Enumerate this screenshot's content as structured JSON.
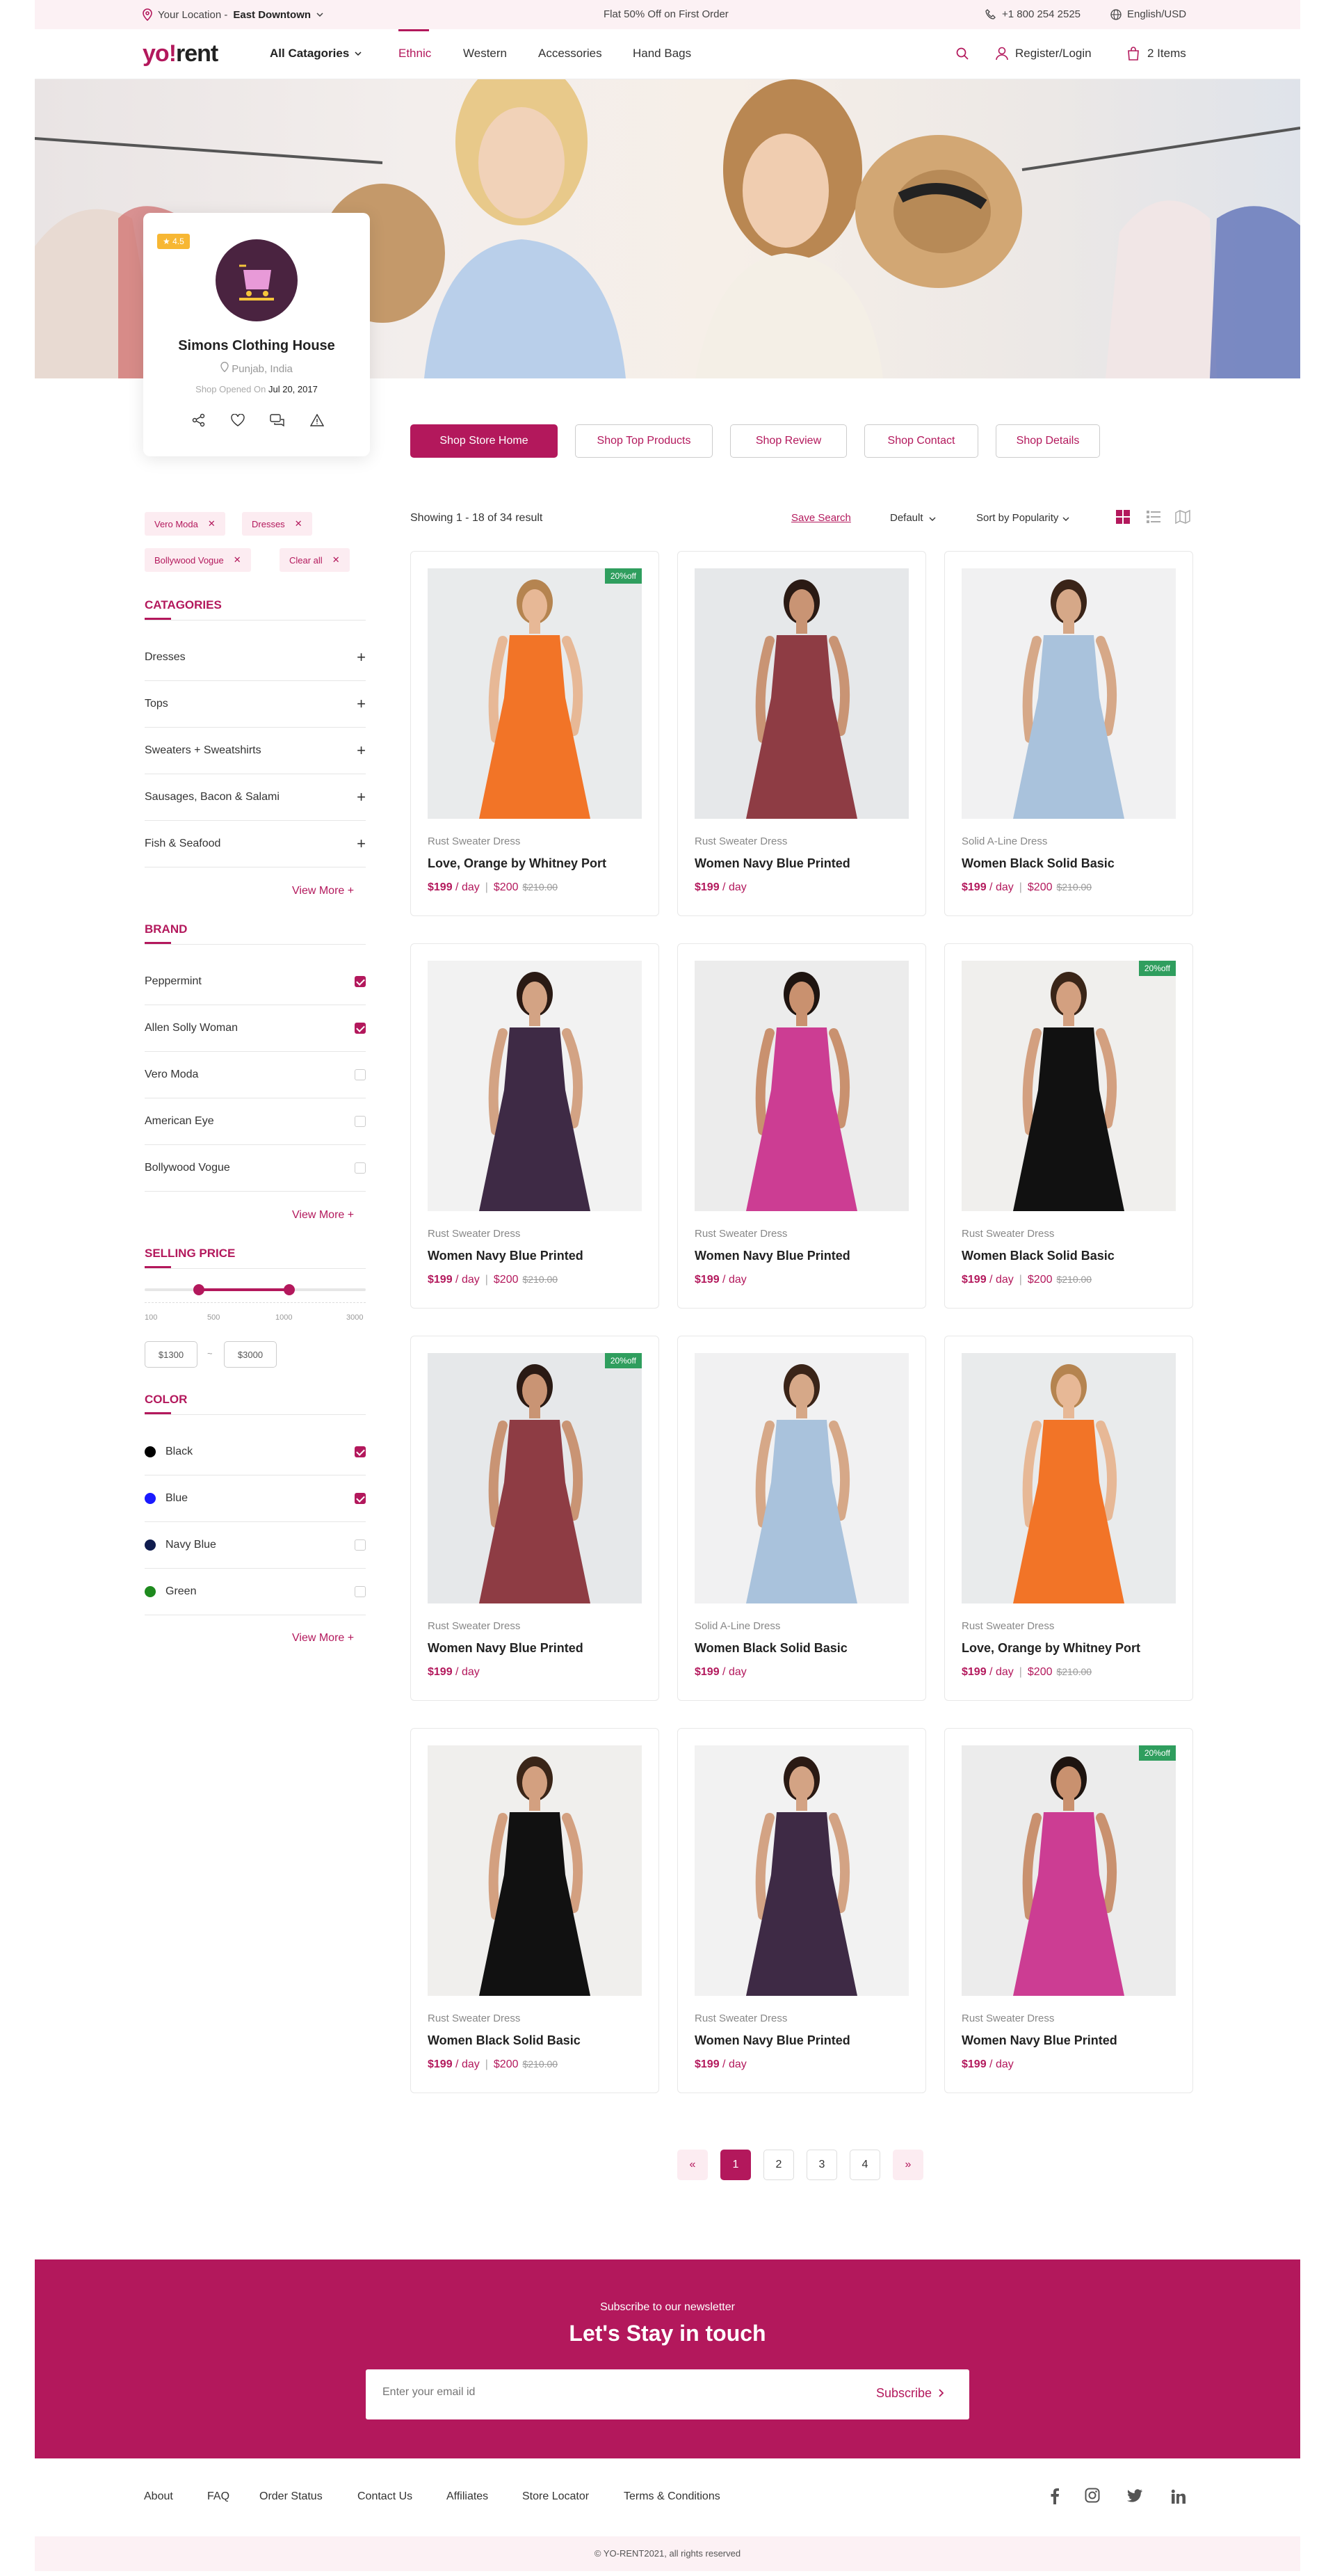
{
  "topbar": {
    "location_label": "Your Location -",
    "location_value": "East Downtown",
    "promo": "Flat 50% Off on First Order",
    "phone": "+1 800 254 2525",
    "language": "English/USD"
  },
  "header": {
    "logo_a": "yo",
    "logo_b": "!",
    "logo_c": "rent",
    "all_categories": "All Catagories",
    "nav": [
      "Ethnic",
      "Western",
      "Accessories",
      "Hand Bags"
    ],
    "register": "Register/Login",
    "cart": "2 Items"
  },
  "store": {
    "rating": "4.5",
    "name": "Simons Clothing House",
    "location": "Punjab, India",
    "opened_label": "Shop Opened On",
    "opened_date": "Jul 20, 2017"
  },
  "shop_tabs": [
    "Shop Store Home",
    "Shop Top Products",
    "Shop Review",
    "Shop Contact",
    "Shop Details"
  ],
  "filters": {
    "chips": [
      "Vero Moda",
      "Dresses",
      "Bollywood Vogue",
      "Clear all"
    ],
    "categories_title": "CATAGORIES",
    "categories": [
      "Dresses",
      "Tops",
      "Sweaters + Sweatshirts",
      "Sausages, Bacon & Salami",
      "Fish & Seafood"
    ],
    "view_more": "View More",
    "brand_title": "BRAND",
    "brands": [
      {
        "label": "Peppermint",
        "checked": true
      },
      {
        "label": "Allen Solly Woman",
        "checked": true
      },
      {
        "label": "Vero Moda",
        "checked": false
      },
      {
        "label": "American Eye",
        "checked": false
      },
      {
        "label": "Bollywood Vogue",
        "checked": false
      }
    ],
    "price_title": "SELLING PRICE",
    "price_ticks": [
      "100",
      "500",
      "1000",
      "3000"
    ],
    "price_min": "$1300",
    "price_sep": "~",
    "price_max": "$3000",
    "color_title": "COLOR",
    "colors": [
      {
        "label": "Black",
        "hex": "#000000",
        "checked": true
      },
      {
        "label": "Blue",
        "hex": "#1a1aff",
        "checked": true
      },
      {
        "label": "Navy Blue",
        "hex": "#101c4e",
        "checked": false
      },
      {
        "label": "Green",
        "hex": "#1e8a1e",
        "checked": false
      }
    ]
  },
  "results": {
    "showing": "Showing 1 - 18 of 34 result",
    "save_search": "Save Search",
    "default_sort": "Default",
    "sort_by": "Sort by Popularity"
  },
  "products": [
    {
      "cat": "Rust Sweater Dress",
      "name": "Love, Orange by Whitney Port",
      "price": "$199",
      "unit": "/ day",
      "sale": "$200",
      "old": "$210.00",
      "badge": "20%off",
      "color": "orange"
    },
    {
      "cat": "Rust Sweater Dress",
      "name": "Women Navy Blue Printed",
      "price": "$199",
      "unit": "/ day",
      "sale": "",
      "old": "",
      "badge": "",
      "color": "maroon"
    },
    {
      "cat": "Solid A-Line Dress",
      "name": "Women Black Solid Basic",
      "price": "$199",
      "unit": "/ day",
      "sale": "$200",
      "old": "$210.00",
      "badge": "",
      "color": "floral"
    },
    {
      "cat": "Rust Sweater Dress",
      "name": "Women Navy Blue Printed",
      "price": "$199",
      "unit": "/ day",
      "sale": "$200",
      "old": "$210.00",
      "badge": "",
      "color": "purple"
    },
    {
      "cat": "Rust Sweater Dress",
      "name": "Women Navy Blue Printed",
      "price": "$199",
      "unit": "/ day",
      "sale": "",
      "old": "",
      "badge": "",
      "color": "pink"
    },
    {
      "cat": "Rust Sweater Dress",
      "name": "Women Black Solid Basic",
      "price": "$199",
      "unit": "/ day",
      "sale": "$200",
      "old": "$210.00",
      "badge": "20%off",
      "color": "black"
    },
    {
      "cat": "Rust Sweater Dress",
      "name": "Women Navy Blue Printed",
      "price": "$199",
      "unit": "/ day",
      "sale": "",
      "old": "",
      "badge": "20%off",
      "color": "maroon"
    },
    {
      "cat": "Solid A-Line Dress",
      "name": "Women Black Solid Basic",
      "price": "$199",
      "unit": "/ day",
      "sale": "",
      "old": "",
      "badge": "",
      "color": "floral"
    },
    {
      "cat": "Rust Sweater Dress",
      "name": "Love, Orange by Whitney Port",
      "price": "$199",
      "unit": "/ day",
      "sale": "$200",
      "old": "$210.00",
      "badge": "",
      "color": "orange"
    },
    {
      "cat": "Rust Sweater Dress",
      "name": "Women Black Solid Basic",
      "price": "$199",
      "unit": "/ day",
      "sale": "$200",
      "old": "$210.00",
      "badge": "",
      "color": "black"
    },
    {
      "cat": "Rust Sweater Dress",
      "name": "Women Navy Blue Printed",
      "price": "$199",
      "unit": "/ day",
      "sale": "",
      "old": "",
      "badge": "",
      "color": "purple"
    },
    {
      "cat": "Rust Sweater Dress",
      "name": "Women Navy Blue Printed",
      "price": "$199",
      "unit": "/ day",
      "sale": "",
      "old": "",
      "badge": "20%off",
      "color": "pink"
    }
  ],
  "pagination": {
    "prev": "«",
    "pages": [
      "1",
      "2",
      "3",
      "4"
    ],
    "next": "»",
    "current": "1"
  },
  "newsletter": {
    "small": "Subscribe to our newsletter",
    "title": "Let's Stay in touch",
    "placeholder": "Enter your email id",
    "button": "Subscribe"
  },
  "footer": {
    "links": [
      "About",
      "FAQ",
      "Order Status",
      "Contact Us",
      "Affiliates",
      "Store Locator",
      "Terms & Conditions"
    ],
    "social": [
      "facebook-icon",
      "instagram-icon",
      "twitter-icon",
      "linkedin-icon"
    ],
    "copyright": "© YO-RENT2021, all rights reserved"
  },
  "colors": {
    "accent": "#b3185c",
    "accent_light": "#fcecf1",
    "badge_green": "#2f9e5e",
    "rating_yellow": "#f7b733"
  }
}
